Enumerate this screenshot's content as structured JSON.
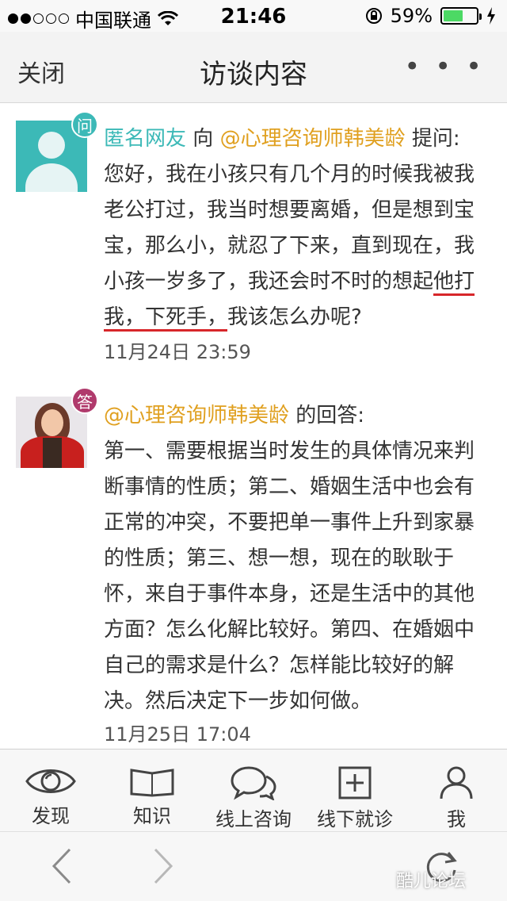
{
  "status_bar": {
    "signal_filled": 2,
    "signal_total": 5,
    "carrier": "中国联通",
    "time": "21:46",
    "battery_text": "59%",
    "battery_level": 0.59
  },
  "nav": {
    "close_label": "关闭",
    "title": "访谈内容",
    "more_label": "• • •"
  },
  "question": {
    "badge": "问",
    "asker": "匿名网友",
    "to_word": "向",
    "expert": "@心理咨询师韩美龄",
    "action": "提问:",
    "body_line1": "您好，我在小孩只有几个月的时候我被我",
    "body_line2": "老公打过，我当时想要离婚，但是想到宝",
    "body_line3": "宝，那么小，就忍了下来，直到现在，我",
    "body_line4a": "小孩一岁多了，我还会时不时的想起",
    "body_line4b": "他打",
    "body_line5a": "我，下死手，",
    "body_line5b": "我该怎么办呢?",
    "timestamp": "11月24日 23:59"
  },
  "answer": {
    "badge": "答",
    "expert": "@心理咨询师韩美龄",
    "suffix": "的回答:",
    "body": "第一、需要根据当时发生的具体情况来判断事情的性质；第二、婚姻生活中也会有正常的冲突，不要把单一事件上升到家暴的性质；第三、想一想，现在的耿耿于怀，来自于事件本身，还是生活中的其他方面？怎么化解比较好。第四、在婚姻中自己的需求是什么？怎样能比较好的解决。然后决定下一步如何做。",
    "timestamp": "11月25日 17:04"
  },
  "tabs": [
    {
      "label": "发现",
      "icon": "eye-icon"
    },
    {
      "label": "知识",
      "icon": "book-icon"
    },
    {
      "label": "线上咨询",
      "icon": "chat-bubbles-icon"
    },
    {
      "label": "线下就诊",
      "icon": "plus-square-icon"
    },
    {
      "label": "我",
      "icon": "person-icon"
    }
  ],
  "watermark": "酷儿论坛"
}
